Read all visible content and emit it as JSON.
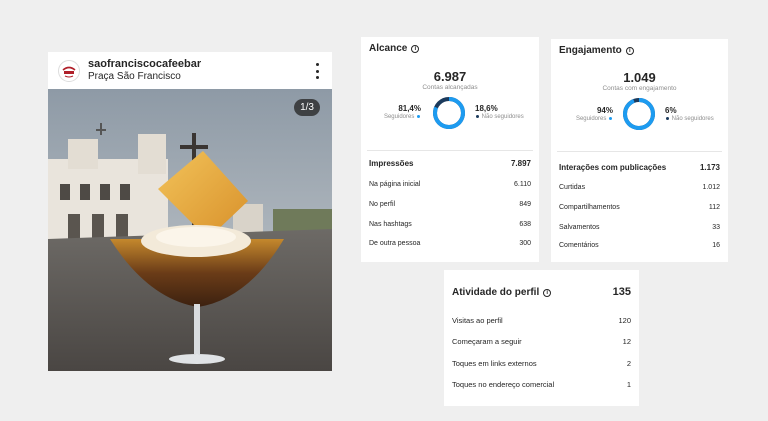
{
  "post": {
    "username": "saofranciscocafeebar",
    "location": "Praça São Francisco",
    "slide_counter": "1/3",
    "avatar_text": "São Francisco"
  },
  "alcance": {
    "title": "Alcance",
    "total": "6.987",
    "total_label": "Contas alcançadas",
    "followers_pct": "81,4%",
    "followers_label": "Seguidores",
    "non_followers_pct": "18,6%",
    "non_followers_label": "Não seguidores",
    "followers_fraction": 0.814,
    "impressions_label": "Impressões",
    "impressions_value": "7.897",
    "rows": [
      {
        "label": "Na página inicial",
        "value": "6.110"
      },
      {
        "label": "No perfil",
        "value": "849"
      },
      {
        "label": "Nas hashtags",
        "value": "638"
      },
      {
        "label": "De outra pessoa",
        "value": "300"
      }
    ]
  },
  "engajamento": {
    "title": "Engajamento",
    "total": "1.049",
    "total_label": "Contas com engajamento",
    "followers_pct": "94%",
    "followers_label": "Seguidores",
    "non_followers_pct": "6%",
    "non_followers_label": "Não seguidores",
    "followers_fraction": 0.94,
    "interactions_label": "Interações com publicações",
    "interactions_value": "1.173",
    "rows": [
      {
        "label": "Curtidas",
        "value": "1.012"
      },
      {
        "label": "Compartilhamentos",
        "value": "112"
      },
      {
        "label": "Salvamentos",
        "value": "33"
      },
      {
        "label": "Comentários",
        "value": "16"
      }
    ]
  },
  "atividade": {
    "title": "Atividade do perfil",
    "total": "135",
    "rows": [
      {
        "label": "Visitas ao perfil",
        "value": "120"
      },
      {
        "label": "Começaram a seguir",
        "value": "12"
      },
      {
        "label": "Toques em links externos",
        "value": "2"
      },
      {
        "label": "Toques no endereço comercial",
        "value": "1"
      }
    ]
  },
  "colors": {
    "followers": "#1d9bf0",
    "non_followers": "#1b3a5c",
    "divider": "#e6e6e6"
  },
  "icons": {
    "info": "info-icon",
    "more": "more-options-icon"
  }
}
